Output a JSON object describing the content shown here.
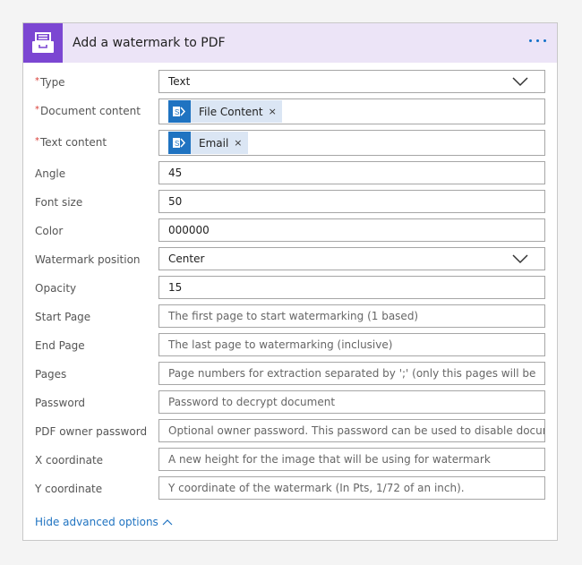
{
  "card": {
    "title": "Add a watermark to PDF",
    "header_icon": "file-cabinet-icon",
    "more_menu_icon": "ellipsis-icon"
  },
  "colors": {
    "accent_purple": "#7b46d2",
    "header_bg": "#ece4f7",
    "link_blue": "#1f73c1",
    "token_bg": "#dbe6f4",
    "required_red": "#d9403a"
  },
  "fields": [
    {
      "label": "Type",
      "required": true,
      "type": "dropdown",
      "value": "Text"
    },
    {
      "label": "Document content",
      "required": true,
      "type": "token",
      "token_label": "File Content",
      "token_icon": "sharepoint-icon"
    },
    {
      "label": "Text content",
      "required": true,
      "type": "token",
      "token_label": "Email",
      "token_icon": "sharepoint-icon"
    },
    {
      "label": "Angle",
      "required": false,
      "type": "text",
      "value": "45"
    },
    {
      "label": "Font size",
      "required": false,
      "type": "text",
      "value": "50"
    },
    {
      "label": "Color",
      "required": false,
      "type": "text",
      "value": "000000"
    },
    {
      "label": "Watermark position",
      "required": false,
      "type": "dropdown",
      "value": "Center"
    },
    {
      "label": "Opacity",
      "required": false,
      "type": "text",
      "value": "15"
    },
    {
      "label": "Start Page",
      "required": false,
      "type": "text",
      "placeholder": "The first page to start watermarking (1 based)"
    },
    {
      "label": "End Page",
      "required": false,
      "type": "text",
      "placeholder": "The last page to watermarking (inclusive)"
    },
    {
      "label": "Pages",
      "required": false,
      "type": "text",
      "placeholder": "Page numbers for extraction separated by ';' (only this pages will be"
    },
    {
      "label": "Password",
      "required": false,
      "type": "text",
      "placeholder": "Password to decrypt document"
    },
    {
      "label": "PDF owner password",
      "required": false,
      "type": "text",
      "placeholder": "Optional owner password. This password can be used to disable document"
    },
    {
      "label": "X coordinate",
      "required": false,
      "type": "text",
      "placeholder": "A new height for the image that will be using for watermark"
    },
    {
      "label": "Y coordinate",
      "required": false,
      "type": "text",
      "placeholder": "Y coordinate of the watermark (In Pts, 1/72 of an inch)."
    }
  ],
  "required_marker": "*",
  "token_close": "×",
  "footer": {
    "hide_advanced_label": "Hide advanced options"
  }
}
